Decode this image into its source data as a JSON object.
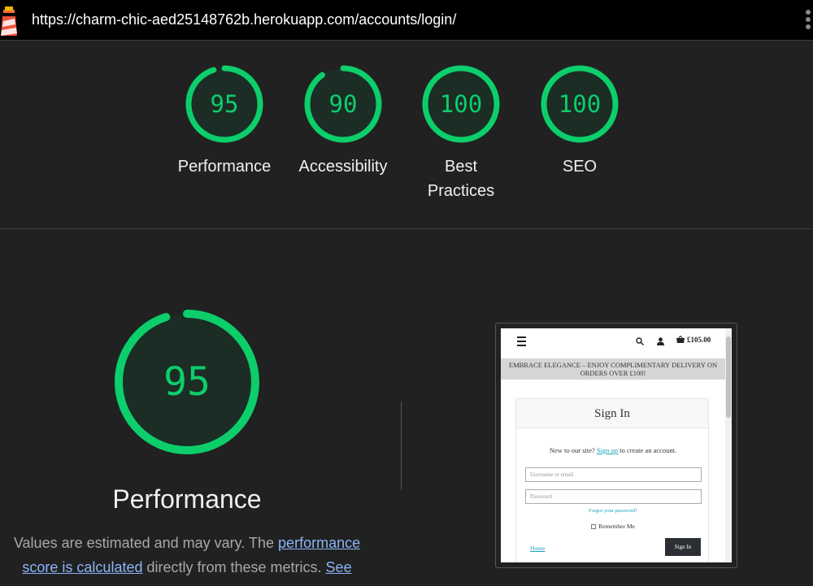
{
  "topbar": {
    "url": "https://charm-chic-aed25148762b.herokuapp.com/accounts/login/"
  },
  "scores": [
    {
      "value": 95,
      "label": "Performance"
    },
    {
      "value": 90,
      "label": "Accessibility"
    },
    {
      "value": 100,
      "label": "Best Practices"
    },
    {
      "value": 100,
      "label": "SEO"
    }
  ],
  "main": {
    "score": 95,
    "title": "Performance",
    "desc_prefix": "Values are estimated and may vary. The ",
    "desc_link": "performance score is calculated",
    "desc_middle": " directly from these metrics. ",
    "desc_see": "See"
  },
  "preview": {
    "basket_total": "£105.00",
    "banner": "EMBRACE ELEGANCE – ENJOY COMPLIMENTARY DELIVERY ON ORDERS OVER £100!",
    "card_title": "Sign In",
    "signup_prefix": "New to our site? ",
    "signup_link": "Sign up",
    "signup_suffix": " to create an account.",
    "username_placeholder": "Username or email",
    "password_placeholder": "Password",
    "forgot": "Forgot your password?",
    "remember": "Remember Me",
    "home": "Home",
    "signin": "Sign In"
  },
  "colors": {
    "pass": "#0cce6b",
    "pass_fill": "#1b2d25",
    "link": "#8ab4f8",
    "background": "#212121"
  }
}
